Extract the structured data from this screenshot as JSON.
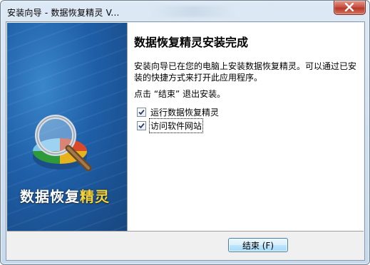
{
  "window": {
    "title": "安装向导 - 数据恢复精灵 V..."
  },
  "banner": {
    "brand_main": "数据恢复",
    "brand_highlight": "精灵"
  },
  "content": {
    "heading": "数据恢复精灵安装完成",
    "description": "安装向导已在您的电脑上安装数据恢复精灵。可以通过已安装的快捷方式来打开此应用程序。",
    "prompt": "点击 “结束” 退出安装。",
    "checkboxes": [
      {
        "label": "运行数据恢复精灵",
        "checked": true
      },
      {
        "label": "访问软件网站",
        "checked": true
      }
    ]
  },
  "footer": {
    "finish_label": "结束 (F)"
  },
  "colors": {
    "banner": "#1f5fa8",
    "brand_highlight": "#f6d33a",
    "button_border": "#3c7fb1"
  },
  "icons": {
    "close": "close-icon",
    "checkbox_checked": "checkmark-icon",
    "banner_art": "magnifier-pie-chart-icon"
  }
}
